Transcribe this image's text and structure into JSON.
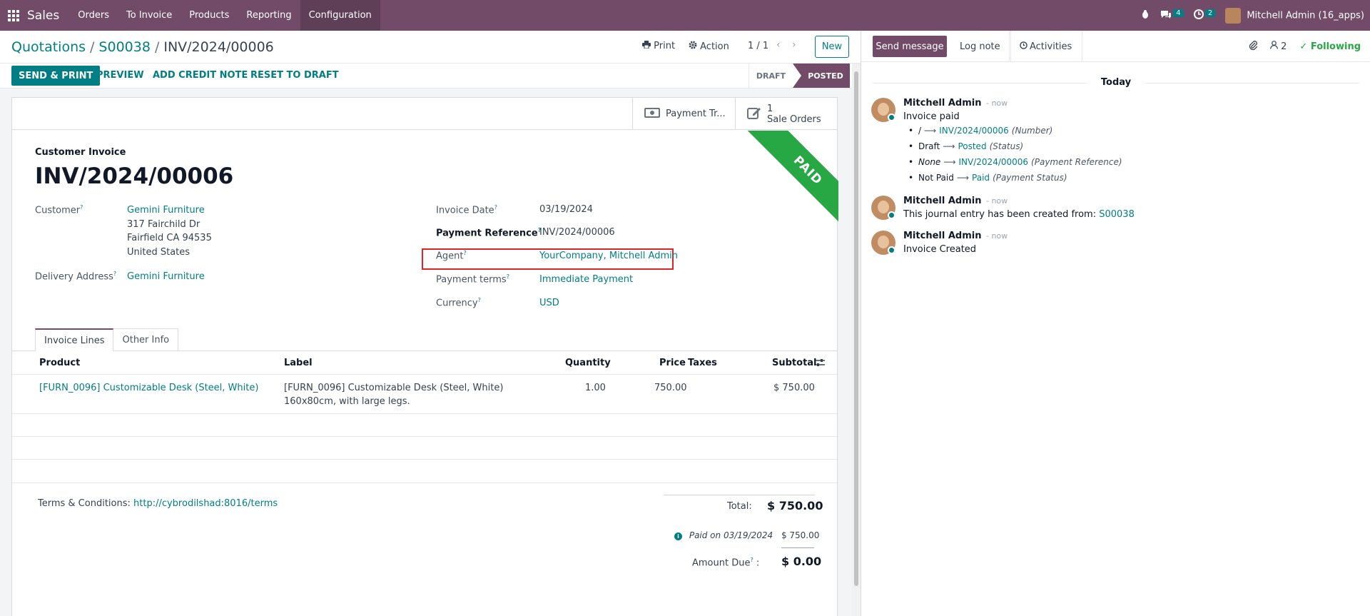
{
  "navbar": {
    "app_name": "Sales",
    "menus": [
      "Orders",
      "To Invoice",
      "Products",
      "Reporting",
      "Configuration"
    ],
    "messages_count": "4",
    "activities_count": "2",
    "user": "Mitchell Admin (16_apps)"
  },
  "breadcrumb": {
    "root": "Quotations",
    "parent": "S00038",
    "current": "INV/2024/00006"
  },
  "controls": {
    "print": "Print",
    "action": "Action",
    "pager": "1 / 1",
    "new": "New"
  },
  "statusbar": {
    "send_print": "SEND & PRINT",
    "preview": "PREVIEW",
    "add_credit_note": "ADD CREDIT NOTE",
    "reset_to_draft": "RESET TO DRAFT",
    "stage_draft": "DRAFT",
    "stage_posted": "POSTED"
  },
  "smart_buttons": {
    "payment": "Payment Tr...",
    "sale_orders_count": "1",
    "sale_orders_label": "Sale Orders"
  },
  "ribbon": "PAID",
  "form": {
    "doc_type": "Customer Invoice",
    "name": "INV/2024/00006",
    "customer_label": "Customer",
    "customer_name": "Gemini Furniture",
    "customer_street": "317 Fairchild Dr",
    "customer_city": "Fairfield CA 94535",
    "customer_country": "United States",
    "delivery_label": "Delivery Address",
    "delivery_value": "Gemini Furniture",
    "invoice_date_label": "Invoice Date",
    "invoice_date": "03/19/2024",
    "payment_ref_label": "Payment Reference",
    "payment_ref": "INV/2024/00006",
    "agent_label": "Agent",
    "agent": "YourCompany, Mitchell Admin",
    "payment_terms_label": "Payment terms",
    "payment_terms": "Immediate Payment",
    "currency_label": "Currency",
    "currency": "USD"
  },
  "tabs": [
    "Invoice Lines",
    "Other Info"
  ],
  "lines": {
    "headers": {
      "product": "Product",
      "label": "Label",
      "quantity": "Quantity",
      "price": "Price",
      "taxes": "Taxes",
      "subtotal": "Subtotal"
    },
    "rows": [
      {
        "product": "[FURN_0096] Customizable Desk (Steel, White)",
        "label_1": "[FURN_0096] Customizable Desk (Steel, White)",
        "label_2": "160x80cm, with large legs.",
        "quantity": "1.00",
        "price": "750.00",
        "taxes": "",
        "subtotal": "$ 750.00"
      }
    ]
  },
  "footer": {
    "terms_label": "Terms & Conditions:",
    "terms_link": "http://cybrodilshad:8016/terms",
    "total_label": "Total:",
    "total_value": "$ 750.00",
    "paid_on": "Paid on 03/19/2024",
    "paid_amount": "$ 750.00",
    "amount_due_label": "Amount Due",
    "amount_due_value": "$ 0.00"
  },
  "chatter": {
    "send_message": "Send message",
    "log_note": "Log note",
    "activities": "Activities",
    "followers_count": "2",
    "following": "Following",
    "date_separator": "Today",
    "messages": [
      {
        "author": "Mitchell Admin",
        "time": "- now",
        "body": "Invoice paid",
        "tracking": [
          {
            "old": "/",
            "new": "INV/2024/00006",
            "field": "(Number)"
          },
          {
            "old": "Draft",
            "new": "Posted",
            "field": "(Status)"
          },
          {
            "old": "None",
            "new": "INV/2024/00006",
            "field": "(Payment Reference)"
          },
          {
            "old": "Not Paid",
            "new": "Paid",
            "field": "(Payment Status)"
          }
        ]
      },
      {
        "author": "Mitchell Admin",
        "time": "- now",
        "body": "This journal entry has been created from:",
        "link": "S00038"
      },
      {
        "author": "Mitchell Admin",
        "time": "- now",
        "body": "Invoice Created"
      }
    ]
  },
  "colors": {
    "brand": "#714b67",
    "accent": "#017e84",
    "paid_ribbon": "#28a745",
    "highlight_border": "#dc2626"
  }
}
